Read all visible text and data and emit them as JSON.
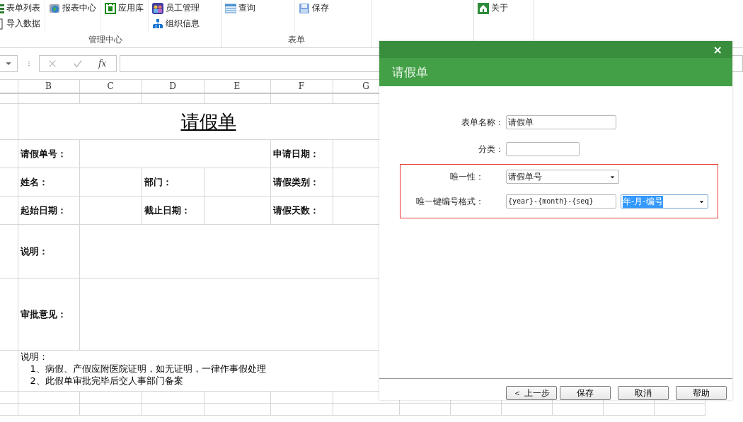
{
  "ribbon": {
    "groups": [
      {
        "label": "管理中心",
        "columns": [
          [
            {
              "label": "表单列表"
            },
            {
              "label": "导入数据"
            }
          ],
          [
            {
              "label": "报表中心"
            }
          ],
          [
            {
              "label": "应用库"
            }
          ],
          [
            {
              "label": "员工管理"
            },
            {
              "label": "组织信息"
            }
          ]
        ]
      },
      {
        "label": "表单",
        "columns": [
          [
            {
              "label": "查询"
            }
          ],
          [
            {
              "label": "保存"
            }
          ]
        ]
      },
      {
        "columns": [
          [
            {
              "label": "关于"
            }
          ]
        ]
      }
    ]
  },
  "formula_bar": {
    "function_label": "fx"
  },
  "sheet": {
    "columns": [
      "B",
      "C",
      "D",
      "E",
      "F",
      "G"
    ],
    "title": "请假单",
    "field_rows": [
      [
        "请假单号：",
        "申请日期："
      ],
      [
        "姓名：",
        "部门：",
        "请假类别："
      ],
      [
        "起始日期：",
        "截止日期：",
        "请假天数："
      ]
    ],
    "text_rows": [
      "说明：",
      "审批意见："
    ],
    "notes": {
      "heading": "说明：",
      "lines": [
        "1、病假、产假应附医院证明，如无证明，一律作事假处理",
        "2、此假单审批完毕后交人事部门备案"
      ]
    }
  },
  "dialog": {
    "title": "请假单",
    "close": "×",
    "fields": [
      {
        "label": "表单名称：",
        "value": "请假单"
      },
      {
        "label": "分类："
      }
    ],
    "unique_box": {
      "key_label": "唯一性：",
      "key_value": "请假单号",
      "format_label": "唯一键编号格式：",
      "format_value": "{year}-{month}-{seq}",
      "preset_value": "年-月-编号",
      "preset_highlighted": true
    },
    "buttons": [
      {
        "label": "＜ 上一步"
      },
      {
        "label": "保存"
      },
      {
        "label": "取消"
      },
      {
        "label": "帮助"
      }
    ]
  }
}
